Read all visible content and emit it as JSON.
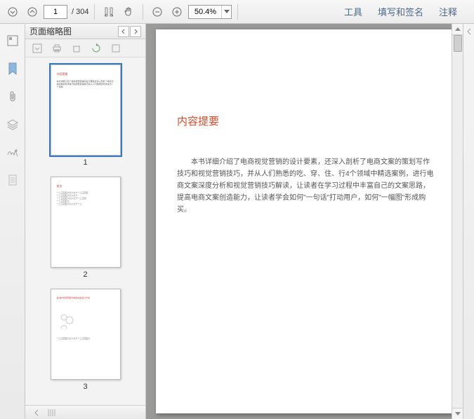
{
  "toolbar": {
    "current_page": "1",
    "total_pages": "/ 304",
    "zoom_value": "50.4%"
  },
  "menu": {
    "tools": "工具",
    "fill_sign": "填写和签名",
    "comment": "注释"
  },
  "thumb_panel": {
    "title": "页面缩略图",
    "thumbs": [
      "1",
      "2",
      "3"
    ]
  },
  "document": {
    "heading": "内容提要",
    "body": "本书详细介绍了电商视觉营销的设计要素，还深入剖析了电商文案的策划写作技巧和视觉营销技巧，并从人们熟悉的吃、穿、住、行4个领域中精选案例，进行电商文案深度分析和视觉营销技巧解读，让读者在学习过程中丰富自己的文案思路，提高电商文案创造能力，让读者学会如何\"一句话\"打动用户，如何\"一幅图\"形成购买。"
  }
}
